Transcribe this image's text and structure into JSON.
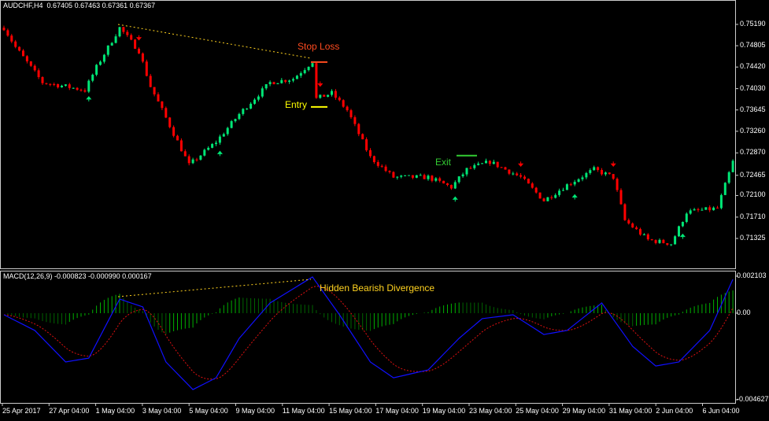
{
  "header": {
    "symbol": "AUDCHF,H4",
    "ohlc": "0.67405 0.67463 0.67361 0.67367"
  },
  "macd_header": {
    "label": "MACD(12,26,9) -0.000823 -0.000990 0.000167"
  },
  "annotations": {
    "stop_loss": "Stop Loss",
    "entry": "Entry",
    "exit": "Exit",
    "divergence": "Hidden Bearish Divergence"
  },
  "colors": {
    "bull": "#00e676",
    "bear": "#ff0000",
    "macd": "#1010ff",
    "signal": "#e01010",
    "histogram": "#00a000",
    "stop_loss": "#ff4b1f",
    "entry": "#ffff00",
    "exit": "#33cc33",
    "divergence": "#ffd21f",
    "grid_text": "#ffffff"
  },
  "chart_data": {
    "type": "candlestick",
    "price_axis": {
      "ticks": [
        "0.75190",
        "0.74805",
        "0.74420",
        "0.74030",
        "0.73645",
        "0.73260",
        "0.72870",
        "0.72465",
        "0.72100",
        "0.71710",
        "0.71325"
      ],
      "range": [
        0.711,
        0.7535
      ]
    },
    "macd_axis": {
      "ticks": [
        "0.002103",
        "0.00",
        "-0.004627"
      ],
      "range": [
        -0.004627,
        0.002103
      ]
    },
    "time_axis": [
      "25 Apr 2017",
      "27 Apr 04:00",
      "1 May 04:00",
      "3 May 04:00",
      "5 May 04:00",
      "9 May 04:00",
      "11 May 04:00",
      "15 May 04:00",
      "17 May 04:00",
      "19 May 04:00",
      "23 May 04:00",
      "25 May 04:00",
      "29 May 04:00",
      "31 May 04:00",
      "2 Jun 04:00",
      "6 Jun 04:00"
    ],
    "bars": 190,
    "price_path": [
      [
        0,
        0.7513
      ],
      [
        3,
        0.7478
      ],
      [
        10,
        0.7414
      ],
      [
        16,
        0.7407
      ],
      [
        21,
        0.74
      ],
      [
        24,
        0.7442
      ],
      [
        30,
        0.7513
      ],
      [
        35,
        0.7471
      ],
      [
        38,
        0.7407
      ],
      [
        43,
        0.7336
      ],
      [
        48,
        0.7265
      ],
      [
        55,
        0.7307
      ],
      [
        61,
        0.7357
      ],
      [
        69,
        0.7414
      ],
      [
        75,
        0.7421
      ],
      [
        80,
        0.7452
      ],
      [
        81,
        0.7385
      ],
      [
        85,
        0.7395
      ],
      [
        89,
        0.7364
      ],
      [
        95,
        0.7279
      ],
      [
        101,
        0.7243
      ],
      [
        110,
        0.7243
      ],
      [
        116,
        0.7225
      ],
      [
        120,
        0.7257
      ],
      [
        126,
        0.7271
      ],
      [
        134,
        0.7243
      ],
      [
        140,
        0.7201
      ],
      [
        146,
        0.7229
      ],
      [
        153,
        0.7257
      ],
      [
        158,
        0.7243
      ],
      [
        161,
        0.7165
      ],
      [
        167,
        0.713
      ],
      [
        173,
        0.7123
      ],
      [
        177,
        0.718
      ],
      [
        185,
        0.7187
      ],
      [
        189,
        0.7271
      ]
    ],
    "macd_path": [
      [
        0,
        -9e-05
      ],
      [
        8,
        -0.00098
      ],
      [
        16,
        -0.00277
      ],
      [
        22,
        -0.00255
      ],
      [
        30,
        0.0008
      ],
      [
        36,
        0.00036
      ],
      [
        42,
        -0.00277
      ],
      [
        49,
        -0.00434
      ],
      [
        55,
        -0.00367
      ],
      [
        61,
        -0.00143
      ],
      [
        69,
        0.00058
      ],
      [
        80,
        0.00206
      ],
      [
        87,
        -9e-05
      ],
      [
        95,
        -0.00277
      ],
      [
        101,
        -0.00367
      ],
      [
        110,
        -0.00322
      ],
      [
        118,
        -0.00143
      ],
      [
        124,
        -0.00031
      ],
      [
        132,
        -9e-05
      ],
      [
        140,
        -0.00121
      ],
      [
        146,
        -0.00098
      ],
      [
        155,
        0.00058
      ],
      [
        163,
        -0.00188
      ],
      [
        169,
        -0.003
      ],
      [
        175,
        -0.00277
      ],
      [
        183,
        -0.00098
      ],
      [
        189,
        0.00192
      ]
    ],
    "trade_levels": {
      "stop_loss": 0.7451,
      "entry": 0.737,
      "exit": 0.7282
    }
  }
}
